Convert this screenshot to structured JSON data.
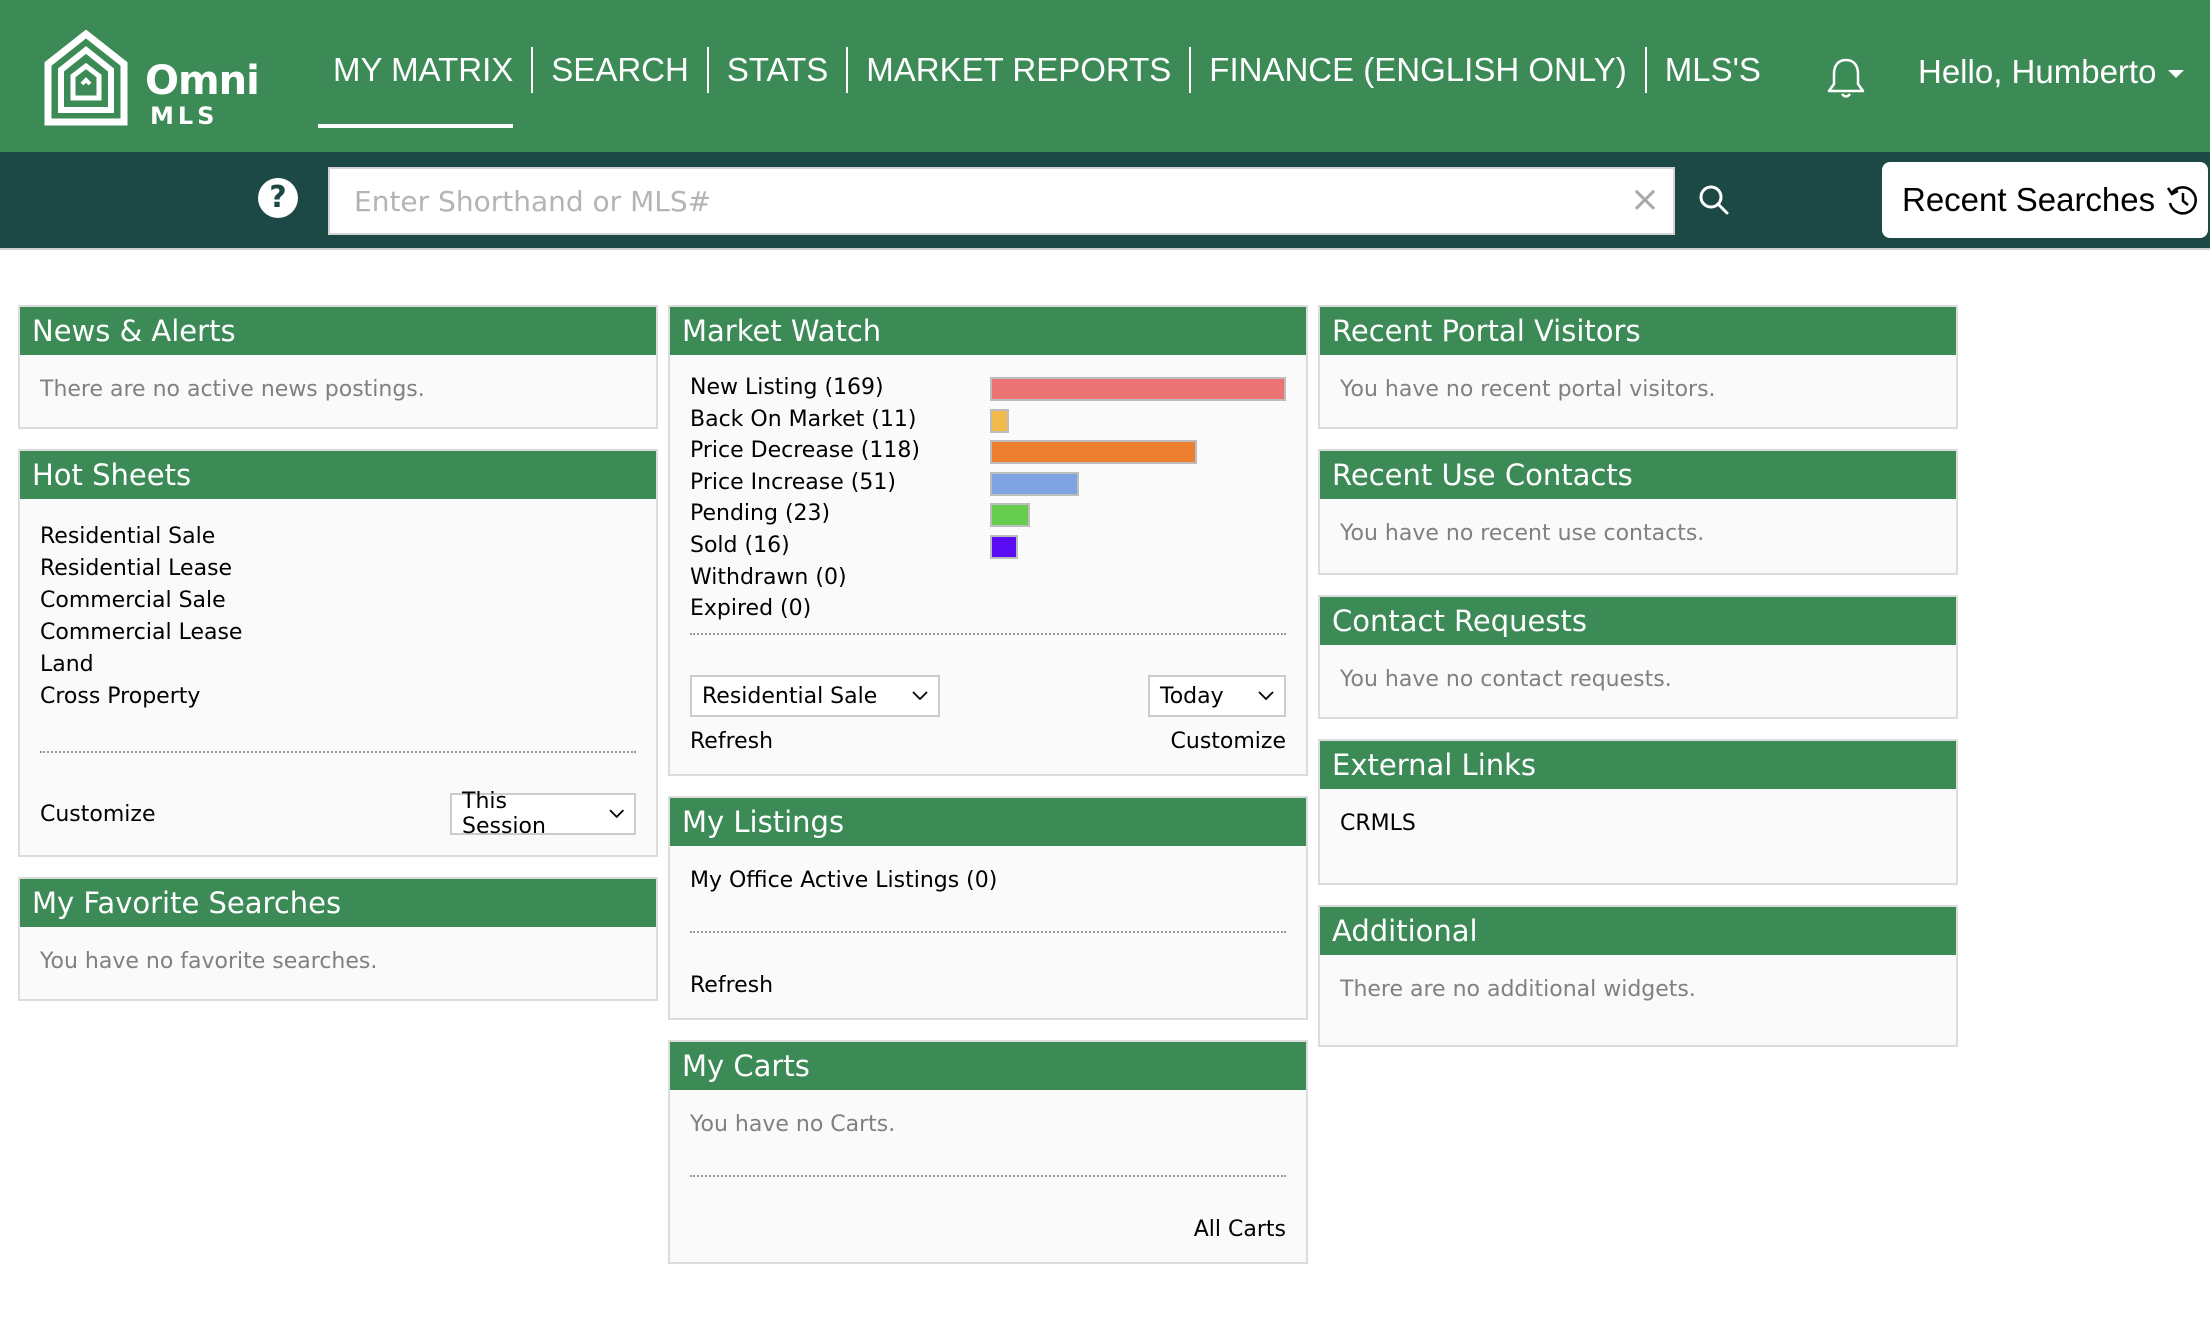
{
  "header": {
    "logo": {
      "name": "Omni",
      "sub": "MLS"
    },
    "nav": [
      {
        "label": "MY MATRIX",
        "active": true
      },
      {
        "label": "SEARCH",
        "active": false
      },
      {
        "label": "STATS",
        "active": false
      },
      {
        "label": "MARKET REPORTS",
        "active": false
      },
      {
        "label": "FINANCE (ENGLISH ONLY)",
        "active": false
      },
      {
        "label": "MLS'S",
        "active": false
      }
    ],
    "user_greeting": "Hello, Humberto"
  },
  "searchbar": {
    "help_icon": "?",
    "placeholder": "Enter Shorthand or MLS#",
    "value": "",
    "clear_icon": "×",
    "recent_searches_label": "Recent Searches"
  },
  "colors": {
    "brand_green": "#3c8a56",
    "dark_teal": "#1c4845"
  },
  "widgets": {
    "news_alerts": {
      "title": "News & Alerts",
      "message": "There are no active news postings."
    },
    "hot_sheets": {
      "title": "Hot Sheets",
      "items": [
        "Residential Sale",
        "Residential Lease",
        "Commercial Sale",
        "Commercial Lease",
        "Land",
        "Cross Property"
      ],
      "customize_label": "Customize",
      "period_select": "This Session"
    },
    "favorite_searches": {
      "title": "My Favorite Searches",
      "message": "You have no favorite searches."
    },
    "market_watch": {
      "title": "Market Watch",
      "property_select": "Residential Sale",
      "period_select": "Today",
      "refresh_label": "Refresh",
      "customize_label": "Customize"
    },
    "my_listings": {
      "title": "My Listings",
      "item": "My Office Active Listings (0)",
      "refresh_label": "Refresh"
    },
    "my_carts": {
      "title": "My Carts",
      "message": "You have no Carts.",
      "all_carts_label": "All Carts"
    },
    "portal_visitors": {
      "title": "Recent Portal Visitors",
      "message": "You have no recent portal visitors."
    },
    "recent_contacts": {
      "title": "Recent Use Contacts",
      "message": "You have no recent use contacts."
    },
    "contact_requests": {
      "title": "Contact Requests",
      "message": "You have no contact requests."
    },
    "external_links": {
      "title": "External Links",
      "links": [
        "CRMLS"
      ]
    },
    "additional": {
      "title": "Additional",
      "message": "There are no additional widgets."
    }
  },
  "chart_data": {
    "type": "bar",
    "title": "Market Watch",
    "orientation": "horizontal",
    "categories": [
      "New Listing",
      "Back On Market",
      "Price Decrease",
      "Price Increase",
      "Pending",
      "Sold",
      "Withdrawn",
      "Expired"
    ],
    "values": [
      169,
      11,
      118,
      51,
      23,
      16,
      0,
      0
    ],
    "labels": [
      "New Listing (169)",
      "Back On Market (11)",
      "Price Decrease (118)",
      "Price Increase (51)",
      "Pending (23)",
      "Sold (16)",
      "Withdrawn (0)",
      "Expired (0)"
    ],
    "colors": [
      "#ec7374",
      "#f0bb4a",
      "#ec7f30",
      "#7fa3e0",
      "#66cc4d",
      "#5a0cf5",
      null,
      null
    ],
    "xlim": [
      0,
      169
    ],
    "grid": false,
    "legend": "none"
  }
}
